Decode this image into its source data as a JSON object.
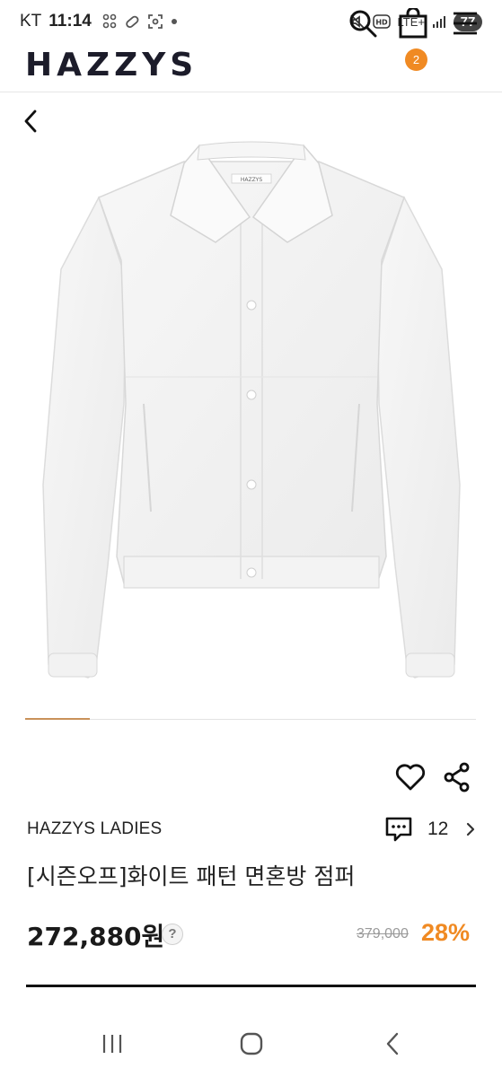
{
  "status_bar": {
    "carrier": "KT",
    "time": "11:14",
    "network": "LTE+",
    "battery": "77"
  },
  "header": {
    "logo": "HAZZYS",
    "cart_count": "2"
  },
  "product": {
    "brand": "HAZZYS LADIES",
    "title": "[시즌오프]화이트 패턴 면혼방 점퍼",
    "review_count": "12",
    "price": "272,880원",
    "price_help": "?",
    "original_price": "379,000",
    "discount": "28%",
    "image_label": "HAZZYS"
  },
  "colors": {
    "accent": "#f08a23",
    "slider_active": "#c9915a"
  },
  "icons": [
    "search-icon",
    "shopping-bag-icon",
    "menu-icon",
    "back-arrow-icon",
    "heart-icon",
    "share-icon",
    "review-icon",
    "chevron-right-icon",
    "recent-apps-icon",
    "home-icon",
    "nav-back-icon"
  ]
}
